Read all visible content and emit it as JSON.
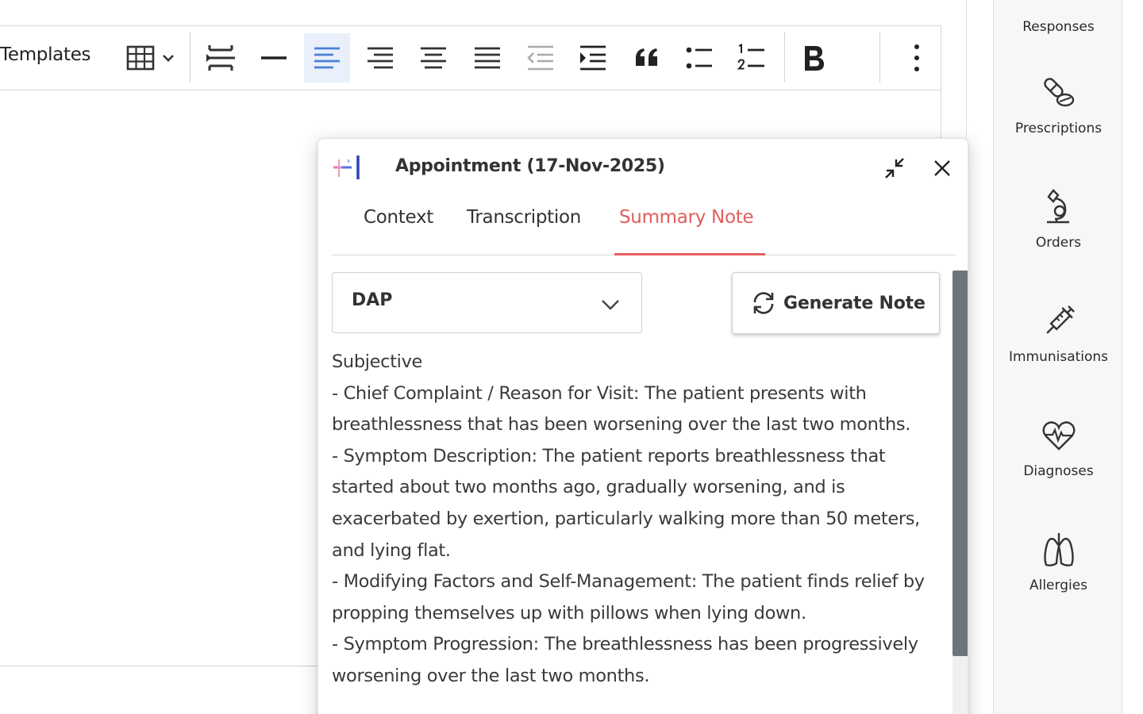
{
  "toolbar": {
    "templates_label": "Templates",
    "buttons": [
      {
        "name": "table-icon"
      },
      {
        "name": "page-break-icon"
      },
      {
        "name": "horizontal-rule-icon"
      },
      {
        "name": "align-left-icon",
        "active": true
      },
      {
        "name": "align-right-icon"
      },
      {
        "name": "align-center-icon"
      },
      {
        "name": "align-justify-icon"
      },
      {
        "name": "outdent-icon"
      },
      {
        "name": "indent-icon"
      },
      {
        "name": "blockquote-icon"
      },
      {
        "name": "bullet-list-icon"
      },
      {
        "name": "numbered-list-icon"
      },
      {
        "name": "bold-icon"
      },
      {
        "name": "more-vertical-icon"
      }
    ],
    "active_color": "#e9f0fb"
  },
  "rail": {
    "items": [
      {
        "label": "Responses",
        "icon": "responses-icon"
      },
      {
        "label": "Prescriptions",
        "icon": "pills-icon"
      },
      {
        "label": "Orders",
        "icon": "microscope-icon"
      },
      {
        "label": "Immunisations",
        "icon": "syringe-icon"
      },
      {
        "label": "Diagnoses",
        "icon": "heart-pulse-icon"
      },
      {
        "label": "Allergies",
        "icon": "lungs-icon"
      }
    ]
  },
  "panel": {
    "title": "Appointment (17-Nov-2025)",
    "tabs": [
      {
        "label": "Context"
      },
      {
        "label": "Transcription"
      },
      {
        "label": "Summary Note",
        "active": true
      }
    ],
    "accent_color": "#e35d5d",
    "note_type": {
      "value": "DAP"
    },
    "generate_button": "Generate Note",
    "note_lines": [
      "Subjective",
      "- Chief Complaint / Reason for Visit: The patient presents with breathlessness that has been worsening over the last two months.",
      "- Symptom Description: The patient reports breathlessness that started about two months ago, gradually worsening, and is exacerbated by exertion, particularly walking more than 50 meters, and lying flat.",
      "- Modifying Factors and Self-Management: The patient finds relief by propping themselves up with pillows when lying down.",
      "- Symptom Progression: The breathlessness has been progressively worsening over the last two months."
    ]
  }
}
